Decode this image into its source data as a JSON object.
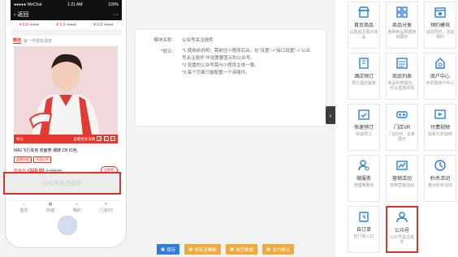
{
  "phone": {
    "status_left": "●●●●● WeChat",
    "status_time": "1:21 AM",
    "status_right": "100%",
    "nav_back": "返回",
    "nav_more": "···",
    "price_strip": [
      {
        "price": "¥ 0.0",
        "old": "¥ 0.0"
      },
      {
        "price": "¥ 0.0",
        "old": "¥ 0.0"
      },
      {
        "price": "¥ 0.0",
        "old": "¥ 0.0"
      }
    ],
    "section_title": "精选",
    "section_sub": "每一件都有温度",
    "product_badge": "特价",
    "product_hint": "查看更多详情",
    "product_name": "MA1飞行夹克 双面穿 潮牌 CB 红色",
    "tag1": "品牌时尚",
    "tag2": "优惠促销",
    "price_label": "秒杀价 ¥",
    "price": "328.00",
    "old_price": "¥ 428.00",
    "buy_button": "立即抢",
    "follow_component": "公众号关注组件",
    "tabs": [
      "首页",
      "商城",
      "我的",
      "门店V3"
    ]
  },
  "form": {
    "name_label": "模块名称：",
    "name_value": "公众号关注组件",
    "tip_label": "*提示：",
    "tips": [
      "*1.使用前说明：需前往小程序后台，在“设置”->“接口设置”->“公众号关注组件”中设置要显示的公众号。",
      "*2.设置的公众号需与小程序主体一致。",
      "*3.每个页面只能配置一个该组件。"
    ]
  },
  "footer": {
    "save": "保存",
    "save_template": "保存至模板",
    "reset": "清空数据",
    "set_default": "设为默认"
  },
  "components": [
    {
      "name": "首页商品",
      "desc": "设置首页展示商品",
      "icon": "shop-icon"
    },
    {
      "name": "商品分类",
      "desc": "各种商品根据类目展示",
      "icon": "category-icon"
    },
    {
      "name": "预约模块",
      "desc": "消息预约，活动预约",
      "icon": "calendar-icon"
    },
    {
      "name": "酒店预订",
      "desc": "预订酒店客房",
      "icon": "hotel-icon"
    },
    {
      "name": "商品列表",
      "desc": "商品列表展示，可以直接添加",
      "icon": "list-icon"
    },
    {
      "name": "商户中心",
      "desc": "手机端商户中心",
      "icon": "merchant-icon"
    },
    {
      "name": "快速预订",
      "desc": "快速预订",
      "icon": "quick-book-icon"
    },
    {
      "name": "门店VR",
      "desc": "门店VR，全景展示",
      "icon": "vr-icon"
    },
    {
      "name": "付费视频",
      "desc": "观看付费视频",
      "icon": "video-icon"
    },
    {
      "name": "微服务",
      "desc": "管理微服务",
      "icon": "user-gear-icon"
    },
    {
      "name": "营销活动",
      "desc": "各种营销活动",
      "icon": "marketing-icon"
    },
    {
      "name": "秒杀活动",
      "desc": "整点秒杀活动",
      "icon": "clock-icon"
    },
    {
      "name": "自订单",
      "desc": "自订单入口",
      "icon": "alarm-icon"
    },
    {
      "name": "公众号",
      "desc": "公众号关注组件",
      "icon": "user-icon"
    },
    {
      "name": "",
      "desc": "",
      "icon": ""
    }
  ],
  "colors": {
    "accent": "#2f7de1",
    "red": "#d9342b",
    "orange": "#f0a93b"
  }
}
